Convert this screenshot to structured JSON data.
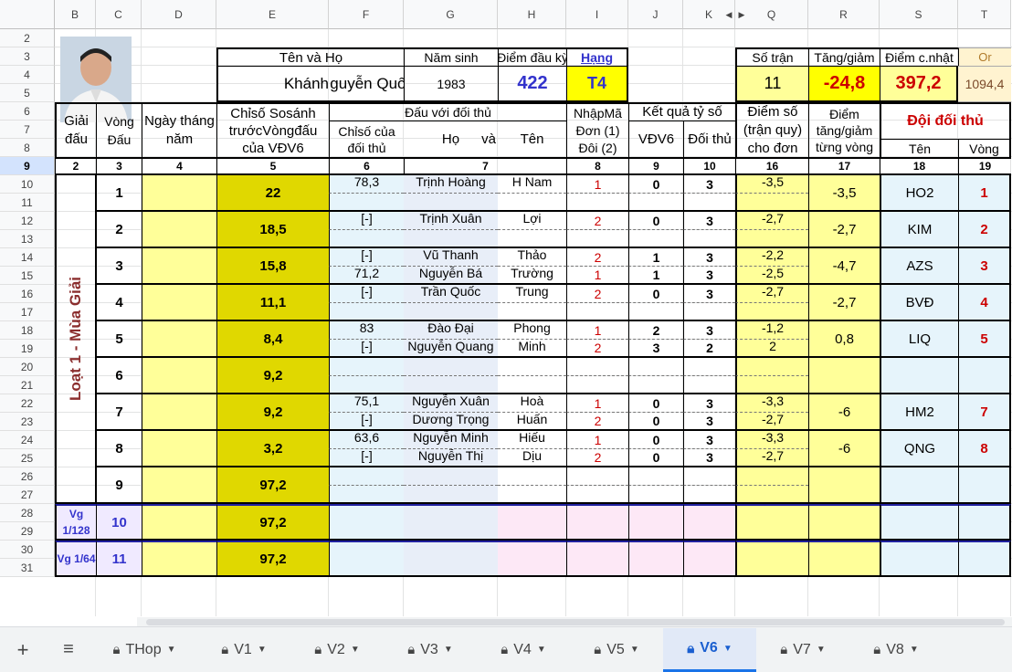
{
  "columns": [
    "B",
    "C",
    "D",
    "E",
    "F",
    "G",
    "H",
    "I",
    "J",
    "K",
    "Q",
    "R",
    "S",
    "T"
  ],
  "rows": [
    "2",
    "3",
    "4",
    "5",
    "6",
    "7",
    "8",
    "9",
    "10",
    "11",
    "12",
    "13",
    "14",
    "15",
    "16",
    "17",
    "18",
    "19",
    "20",
    "21",
    "22",
    "23",
    "24",
    "25",
    "26",
    "27",
    "28",
    "29",
    "30",
    "31"
  ],
  "header": {
    "ten_va_ho": "Tên    và    Họ",
    "nam_sinh_label": "Năm sinh",
    "diem_dau_ky_label": "Điểm đầu kỳ",
    "hang_label": "Hạng",
    "ten": "Khánh",
    "ho": "Nguyễn Quốc",
    "nam_sinh": "1983",
    "diem_dau_ky": "422",
    "hang": "T4"
  },
  "summary": {
    "so_tran_label": "Số trận",
    "tang_giam_label": "Tăng/giảm",
    "diem_cnhat_label": "Điểm c.nhật",
    "or_label": "Or",
    "so_tran": "11",
    "tang_giam": "-24,8",
    "diem_cnhat": "397,2",
    "or": "1094,4"
  },
  "thead": {
    "giai_dau": "Giải đấu",
    "vong_dau": "Vòng Đấu",
    "ngay": "Ngày tháng năm",
    "chiso": "Chỉsố Sosánh trướcVòngđấu của VĐV6",
    "dau_voi": "Đấu với đối thủ",
    "chiso_doi_thu": "Chỉsố của đối thủ",
    "ho": "Họ",
    "va": "và",
    "ten": "Tên",
    "nhap_ma": "NhậpMã Đơn (1) Đôi (2)",
    "ket_qua": "Kết quả tỷ số",
    "vdv6": "VĐV6",
    "doi_thu": "Đối thủ",
    "diem_so": "Điểm số (trận quy) cho đơn",
    "diem_tg": "Điểm tăng/giảm từng vòng",
    "doi_doi_thu": "Đội đối thủ",
    "ten_doi": "Tên",
    "vong": "Vòng"
  },
  "colnums": [
    "2",
    "3",
    "4",
    "5",
    "6",
    "7",
    "",
    "8",
    "9",
    "10",
    "16",
    "17",
    "18",
    "19"
  ],
  "loat_label": "Loạt 1 - Mùa Giải",
  "rounds": [
    {
      "vong": "1",
      "chiso": "22",
      "tg": "-3,5",
      "team": "HO2",
      "team_vong": "1",
      "lines": [
        {
          "cs": "78,3",
          "ho": "Trịnh Hoàng",
          "ten": "H Nam",
          "ma": "1",
          "a": "0",
          "b": "3",
          "d": "-3,5"
        },
        {}
      ]
    },
    {
      "vong": "2",
      "chiso": "18,5",
      "tg": "-2,7",
      "team": "KIM",
      "team_vong": "2",
      "lines": [
        {
          "cs": "[-]",
          "ho": "Trịnh Xuân",
          "ten": "Lợi",
          "ma": "2",
          "a": "0",
          "b": "3",
          "d": "-2,7"
        },
        {}
      ]
    },
    {
      "vong": "3",
      "chiso": "15,8",
      "tg": "-4,7",
      "team": "AZS",
      "team_vong": "3",
      "lines": [
        {
          "cs": "[-]",
          "ho": "Vũ Thanh",
          "ten": "Thảo",
          "ma": "2",
          "a": "1",
          "b": "3",
          "d": "-2,2"
        },
        {
          "cs": "71,2",
          "ho": "Nguyễn Bá",
          "ten": "Trường",
          "ma": "1",
          "a": "1",
          "b": "3",
          "d": "-2,5"
        }
      ]
    },
    {
      "vong": "4",
      "chiso": "11,1",
      "tg": "-2,7",
      "team": "BVĐ",
      "team_vong": "4",
      "lines": [
        {
          "cs": "[-]",
          "ho": "Trần Quốc",
          "ten": "Trung",
          "ma": "2",
          "a": "0",
          "b": "3",
          "d": "-2,7"
        },
        {}
      ]
    },
    {
      "vong": "5",
      "chiso": "8,4",
      "tg": "0,8",
      "team": "LIQ",
      "team_vong": "5",
      "lines": [
        {
          "cs": "83",
          "ho": "Đào Đại",
          "ten": "Phong",
          "ma": "1",
          "a": "2",
          "b": "3",
          "d": "-1,2"
        },
        {
          "cs": "[-]",
          "ho": "Nguyễn Quang",
          "ten": "Minh",
          "ma": "2",
          "a": "3",
          "b": "2",
          "d": "2"
        }
      ]
    },
    {
      "vong": "6",
      "chiso": "9,2",
      "tg": "",
      "team": "",
      "team_vong": "",
      "lines": [
        {},
        {}
      ]
    },
    {
      "vong": "7",
      "chiso": "9,2",
      "tg": "-6",
      "team": "HM2",
      "team_vong": "7",
      "lines": [
        {
          "cs": "75,1",
          "ho": "Nguyễn Xuân",
          "ten": "Hoà",
          "ma": "1",
          "a": "0",
          "b": "3",
          "d": "-3,3"
        },
        {
          "cs": "[-]",
          "ho": "Dương Trọng",
          "ten": "Huấn",
          "ma": "2",
          "a": "0",
          "b": "3",
          "d": "-2,7"
        }
      ]
    },
    {
      "vong": "8",
      "chiso": "3,2",
      "tg": "-6",
      "team": "QNG",
      "team_vong": "8",
      "lines": [
        {
          "cs": "63,6",
          "ho": "Nguyễn Minh",
          "ten": "Hiếu",
          "ma": "1",
          "a": "0",
          "b": "3",
          "d": "-3,3"
        },
        {
          "cs": "[-]",
          "ho": "Nguyễn Thị",
          "ten": "Dịu",
          "ma": "2",
          "a": "0",
          "b": "3",
          "d": "-2,7"
        }
      ]
    },
    {
      "vong": "9",
      "chiso": "97,2",
      "tg": "",
      "team": "",
      "team_vong": "",
      "lines": [
        {},
        {}
      ]
    }
  ],
  "vg": [
    {
      "label": "Vg 1/128",
      "vong": "10",
      "chiso": "97,2"
    },
    {
      "label": "Vg 1/64",
      "vong": "11",
      "chiso": "97,2"
    }
  ],
  "tabs": [
    "THop",
    "V1",
    "V2",
    "V3",
    "V4",
    "V5",
    "V6",
    "V7",
    "V8"
  ],
  "active_tab": "V6",
  "colors": {
    "yellow": "#ffff00",
    "light_yellow": "#ffff99",
    "olive": "#e0d800",
    "light_blue": "#e6f4fb",
    "blue_text": "#3333cc",
    "red_text": "#cc0000",
    "brown": "#8b2e2e"
  }
}
